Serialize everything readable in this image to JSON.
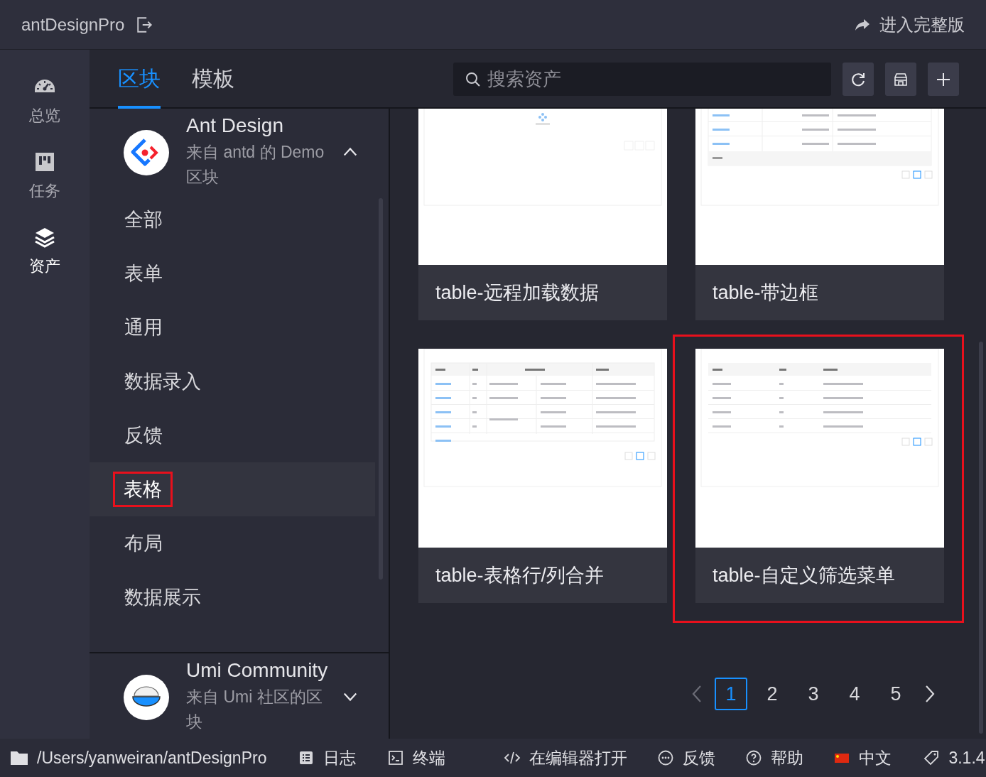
{
  "top_bar": {
    "project": "antDesignPro",
    "action": "进入完整版"
  },
  "nav": [
    {
      "kind": "dashboard",
      "label": "总览",
      "selected": false
    },
    {
      "kind": "board",
      "label": "任务",
      "selected": false
    },
    {
      "kind": "layers",
      "label": "资产",
      "selected": true
    }
  ],
  "tabs": [
    {
      "label": "区块",
      "selected": true
    },
    {
      "label": "模板",
      "selected": false
    }
  ],
  "search": {
    "placeholder": "搜索资产"
  },
  "groups": [
    {
      "kind": "antd",
      "name": "Ant Design",
      "description": "来自 antd 的 Demo 区块",
      "expanded": true,
      "categories": [
        {
          "label": "全部",
          "selected": false
        },
        {
          "label": "表单",
          "selected": false
        },
        {
          "label": "通用",
          "selected": false
        },
        {
          "label": "数据录入",
          "selected": false
        },
        {
          "label": "反馈",
          "selected": false
        },
        {
          "label": "表格",
          "selected": true
        },
        {
          "label": "布局",
          "selected": false
        },
        {
          "label": "数据展示",
          "selected": false
        }
      ]
    },
    {
      "kind": "umi",
      "name": "Umi Community",
      "description": "来自 Umi 社区的区块",
      "expanded": false
    }
  ],
  "cards": [
    {
      "kind": "loading",
      "title": "table-远程加载数据",
      "highlighted": false
    },
    {
      "kind": "bordered",
      "title": "table-带边框",
      "highlighted": false
    },
    {
      "kind": "merged",
      "title": "table-表格行/列合并",
      "highlighted": false
    },
    {
      "kind": "filter",
      "title": "table-自定义筛选菜单",
      "highlighted": true
    }
  ],
  "pagination": {
    "pages": [
      {
        "label": "1",
        "selected": true
      },
      {
        "label": "2",
        "selected": false
      },
      {
        "label": "3",
        "selected": false
      },
      {
        "label": "4",
        "selected": false
      },
      {
        "label": "5",
        "selected": false
      }
    ]
  },
  "status_bar": {
    "path": "/Users/yanweiran/antDesignPro",
    "items": [
      {
        "kind": "log",
        "label": "日志"
      },
      {
        "kind": "terminal",
        "label": "终端"
      },
      {
        "kind": "code",
        "label": "在编辑器打开"
      },
      {
        "kind": "chat",
        "label": "反馈"
      },
      {
        "kind": "help",
        "label": "帮助"
      },
      {
        "kind": "flag",
        "label": "中文"
      },
      {
        "kind": "tag",
        "label": "3.1.4"
      }
    ]
  }
}
